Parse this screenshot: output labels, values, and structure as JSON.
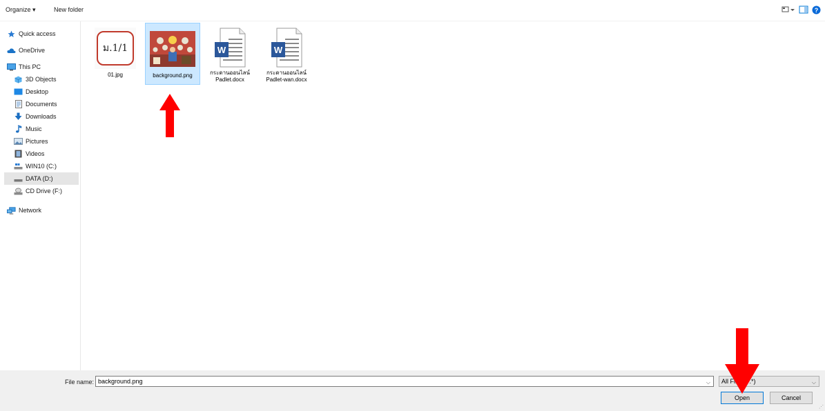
{
  "toolbar": {
    "organize_label": "Organize ▾",
    "new_folder_label": "New folder"
  },
  "nav": {
    "items": [
      {
        "label": "Quick access",
        "icon": "star-icon"
      },
      {
        "label": "OneDrive",
        "icon": "cloud-icon"
      },
      {
        "label": "This PC",
        "icon": "monitor-icon"
      },
      {
        "label": "3D Objects",
        "icon": "cube-icon"
      },
      {
        "label": "Desktop",
        "icon": "desktop-icon"
      },
      {
        "label": "Documents",
        "icon": "document-icon"
      },
      {
        "label": "Downloads",
        "icon": "download-arrow-icon"
      },
      {
        "label": "Music",
        "icon": "music-note-icon"
      },
      {
        "label": "Pictures",
        "icon": "picture-icon"
      },
      {
        "label": "Videos",
        "icon": "film-icon"
      },
      {
        "label": "WIN10 (C:)",
        "icon": "drive-icon"
      },
      {
        "label": "DATA (D:)",
        "icon": "drive-icon",
        "selected": true
      },
      {
        "label": "CD Drive (F:)",
        "icon": "cd-drive-icon"
      },
      {
        "label": "Network",
        "icon": "network-icon"
      }
    ]
  },
  "files": [
    {
      "name": "01.jpg",
      "thumb_text": "ม.1/1",
      "icon": "image-thumbnail"
    },
    {
      "name": "background.png",
      "icon": "image-thumbnail",
      "selected": true
    },
    {
      "name": "กระดานออนไลน์\nPadlet.docx",
      "icon": "word-document-icon"
    },
    {
      "name": "กระดานออนไลน์\nPadlet-wan.docx",
      "icon": "word-document-icon"
    }
  ],
  "bottom": {
    "file_name_label": "File name:",
    "file_name_value": "background.png",
    "file_type_value": "All Files (*.*)",
    "open_label": "Open",
    "cancel_label": "Cancel"
  },
  "colors": {
    "selection_bg": "#cce8ff",
    "selection_border": "#99d1ff",
    "accent_blue": "#0078d7",
    "arrow_red": "#ff0000",
    "word_blue": "#2b579a"
  }
}
